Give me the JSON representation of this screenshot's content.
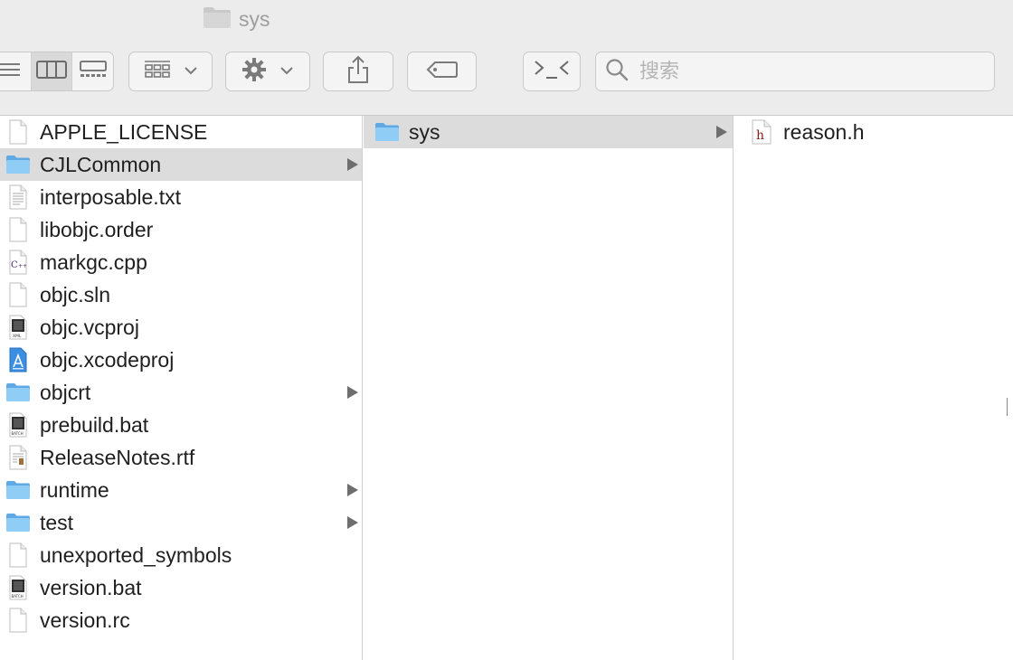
{
  "window": {
    "title": "sys",
    "title_icon": "folder-icon"
  },
  "toolbar": {
    "view_buttons": [
      "list-view-icon",
      "column-view-icon",
      "gallery-view-icon"
    ],
    "group_icon": "group-by-icon",
    "action_icon": "gear-icon",
    "share_icon": "share-icon",
    "tag_icon": "tag-icon",
    "terminal_icon": "terminal-icon",
    "search": {
      "placeholder": "搜索",
      "value": ""
    }
  },
  "columns": [
    {
      "items": [
        {
          "name": "APPLE_LICENSE",
          "icon": "blank-file-icon"
        },
        {
          "name": "CJLCommon",
          "icon": "folder-icon",
          "folder": true,
          "selected": true
        },
        {
          "name": "interposable.txt",
          "icon": "text-file-icon"
        },
        {
          "name": "libobjc.order",
          "icon": "blank-file-icon"
        },
        {
          "name": "markgc.cpp",
          "icon": "cpp-file-icon"
        },
        {
          "name": "objc.sln",
          "icon": "blank-file-icon"
        },
        {
          "name": "objc.vcproj",
          "icon": "xml-file-icon"
        },
        {
          "name": "objc.xcodeproj",
          "icon": "xcode-project-icon"
        },
        {
          "name": "objcrt",
          "icon": "folder-icon",
          "folder": true
        },
        {
          "name": "prebuild.bat",
          "icon": "batch-file-icon"
        },
        {
          "name": "ReleaseNotes.rtf",
          "icon": "rtf-file-icon"
        },
        {
          "name": "runtime",
          "icon": "folder-icon",
          "folder": true
        },
        {
          "name": "test",
          "icon": "folder-icon",
          "folder": true
        },
        {
          "name": "unexported_symbols",
          "icon": "blank-file-icon"
        },
        {
          "name": "version.bat",
          "icon": "batch-file-icon"
        },
        {
          "name": "version.rc",
          "icon": "blank-file-icon"
        }
      ]
    },
    {
      "items": [
        {
          "name": "sys",
          "icon": "folder-icon",
          "folder": true,
          "selected": true
        }
      ]
    },
    {
      "items": [
        {
          "name": "reason.h",
          "icon": "header-file-icon"
        }
      ]
    }
  ],
  "colors": {
    "selection": "#dcdcdc",
    "folder": "#7ec3f1",
    "toolbar_bg": "#ececec"
  }
}
